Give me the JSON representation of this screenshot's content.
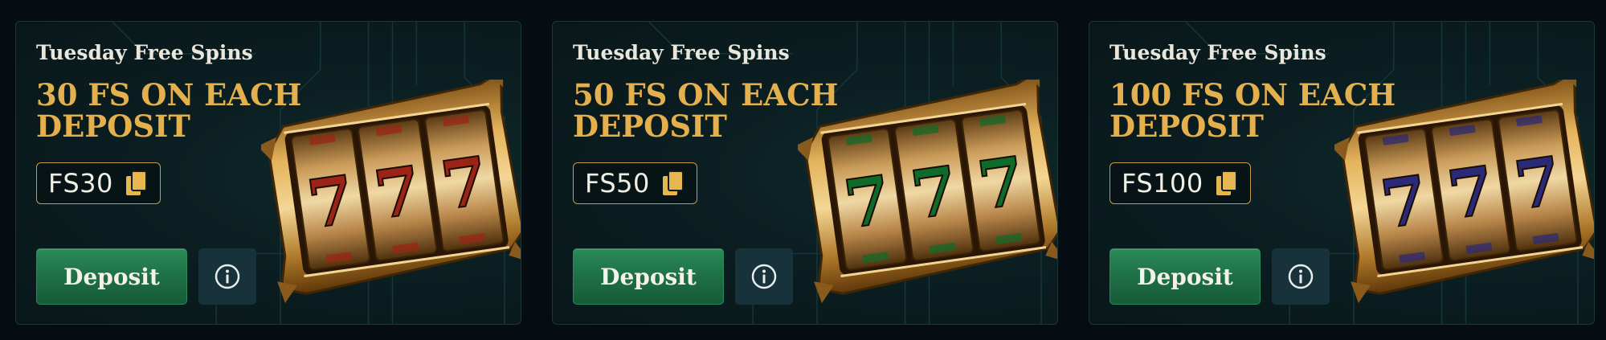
{
  "colors": {
    "headline": "#e3b04d",
    "deposit_button": "#1f7348",
    "card_background": "#0b1e21"
  },
  "cards": [
    {
      "title": "Tuesday Free Spins",
      "headline": "30 FS ON EACH DEPOSIT",
      "promo_code": "FS30",
      "deposit_label": "Deposit",
      "reel_symbol": "7",
      "reel_color": "#9c2416"
    },
    {
      "title": "Tuesday Free Spins",
      "headline": "50 FS ON EACH DEPOSIT",
      "promo_code": "FS50",
      "deposit_label": "Deposit",
      "reel_symbol": "7",
      "reel_color": "#0f6b2a"
    },
    {
      "title": "Tuesday Free Spins",
      "headline": "100 FS ON EACH DEPOSIT",
      "promo_code": "FS100",
      "deposit_label": "Deposit",
      "reel_symbol": "7",
      "reel_color": "#2b2a78"
    }
  ]
}
